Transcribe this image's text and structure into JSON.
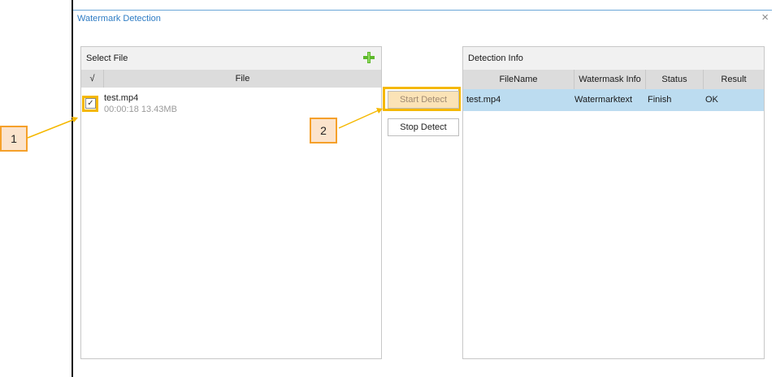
{
  "dialog": {
    "title": "Watermark Detection",
    "close_glyph": "×"
  },
  "left_panel": {
    "title": "Select File",
    "add_icon": "plus-icon",
    "columns": {
      "check": "√",
      "file": "File"
    },
    "files": [
      {
        "name": "test.mp4",
        "duration": "00:00:18",
        "size": "13.43MB",
        "checked": true,
        "check_glyph": "✓"
      }
    ]
  },
  "actions": {
    "start_label": "Start Detect",
    "stop_label": "Stop Detect"
  },
  "right_panel": {
    "title": "Detection Info",
    "columns": [
      "FileName",
      "Watermask Info",
      "Status",
      "Result"
    ],
    "rows": [
      {
        "filename": "test.mp4",
        "watermark_info": "Watermarktext",
        "status": "Finish",
        "result": "OK"
      }
    ]
  },
  "annotations": {
    "callout_1": "1",
    "callout_2": "2"
  },
  "colors": {
    "accent": "#2e7cc4",
    "highlight": "#f5b800",
    "callout_fill": "#fbe3cc",
    "callout_border": "#f5a02a",
    "selected_row": "#bcdcf0",
    "add_icon": "#5cb82a"
  }
}
